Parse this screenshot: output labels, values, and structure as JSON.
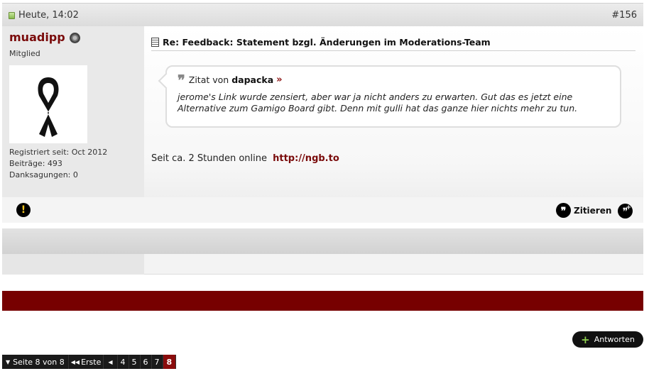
{
  "post": {
    "date": "Heute, 14:02",
    "number": "#156",
    "title": "Re: Feedback: Statement bzgl. Änderungen im Moderations-Team",
    "text": "Seit ca. 2 Stunden online",
    "link": "http://ngb.to"
  },
  "user": {
    "name": "muadipp",
    "title": "Mitglied",
    "registered": "Registriert seit: Oct 2012",
    "posts": "Beiträge: 493",
    "thanks": "Danksagungen: 0"
  },
  "quote": {
    "prefix": "Zitat von",
    "author": "dapacka",
    "text": "jerome's Link wurde zensiert, aber war ja nicht anders zu erwarten. Gut das es jetzt eine Alternative zum Gamigo Board gibt. Denn mit gulli hat das ganze hier nichts mehr zu tun."
  },
  "actions": {
    "quote_label": "Zitieren",
    "reply_label": "Antworten"
  },
  "pagination": {
    "label": "Seite 8 von 8",
    "first": "Erste",
    "pages": [
      "4",
      "5",
      "6",
      "7"
    ],
    "current": "8"
  },
  "colors": {
    "accent": "#770000",
    "username": "#7a0b0b"
  }
}
